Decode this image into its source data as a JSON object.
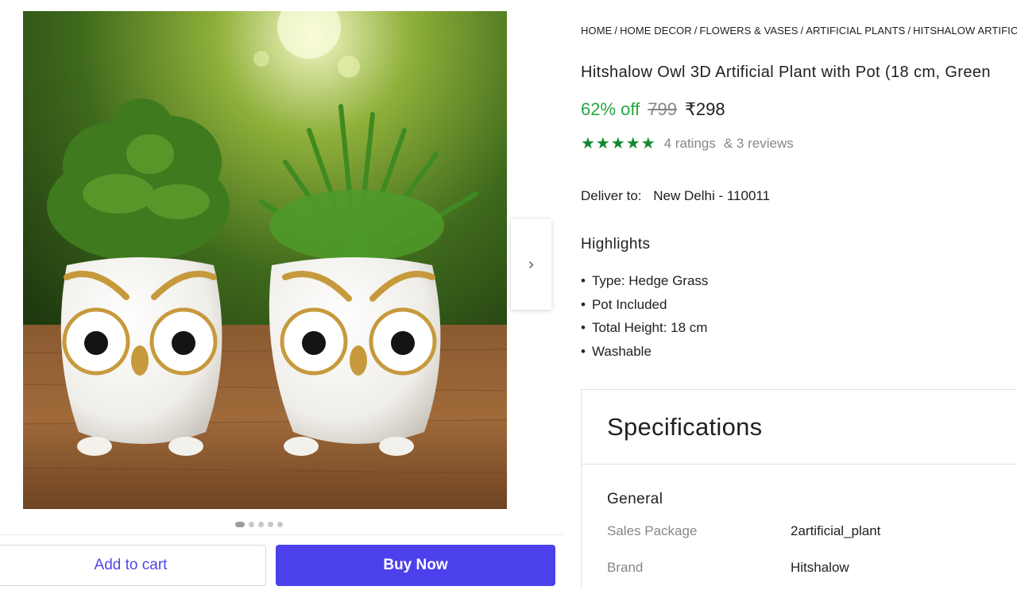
{
  "breadcrumb": [
    "HOME",
    "HOME DECOR",
    "FLOWERS & VASES",
    "ARTIFICIAL PLANTS",
    "HITSHALOW ARTIFICIAL"
  ],
  "product": {
    "title": "Hitshalow Owl 3D Artificial Plant  with Pot (18 cm, Green",
    "discount": "62% off",
    "mrp": "799",
    "price": "₹298",
    "stars": "★★★★★",
    "ratings": "4 ratings",
    "reviews": "& 3 reviews"
  },
  "delivery": {
    "label": "Deliver to:",
    "location": "New Delhi - 110011"
  },
  "highlights": {
    "title": "Highlights",
    "items": [
      "Type: Hedge Grass",
      "Pot Included",
      "Total Height: 18 cm",
      "Washable"
    ]
  },
  "specifications": {
    "title": "Specifications",
    "section": "General",
    "rows": [
      {
        "key": "Sales Package",
        "value": "2artificial_plant"
      },
      {
        "key": "Brand",
        "value": "Hitshalow"
      }
    ]
  },
  "gallery": {
    "next_icon": "›",
    "dots_count": 5,
    "active_index": 0
  },
  "actions": {
    "add_to_cart": "Add to cart",
    "buy_now": "Buy Now"
  },
  "colors": {
    "accent": "#4c40ed",
    "discount": "#26a541",
    "stars": "#0e8a2e"
  }
}
